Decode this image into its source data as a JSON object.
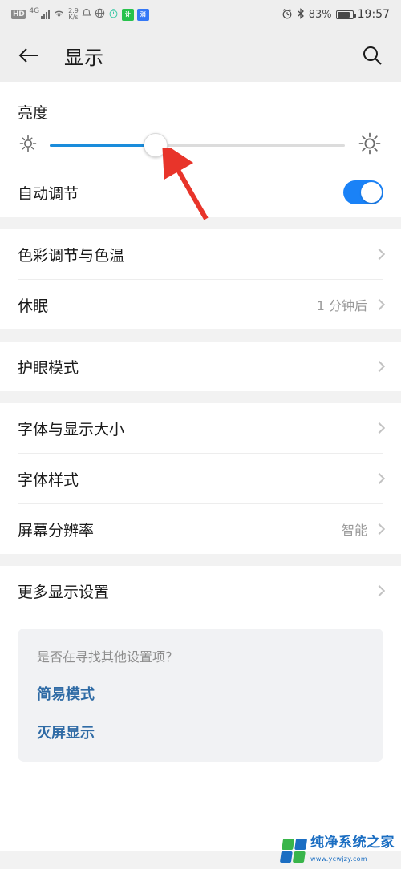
{
  "status_bar": {
    "hd_label": "HD",
    "network_type": "4G",
    "signal_icon": "signal-bars-icon",
    "wifi_icon": "wifi-icon",
    "data_rate_value": "2.9",
    "data_rate_unit": "K/s",
    "silent_icon": "bell-silent-icon",
    "globe_icon": "globe-icon",
    "timer_icon": "stopwatch-icon",
    "chip_green_label": "计",
    "chip_blue_label": "消",
    "alarm_icon": "alarm-clock-icon",
    "bluetooth_icon": "bluetooth-icon",
    "battery_percent": "83%",
    "battery_icon": "battery-icon",
    "time": "19:57"
  },
  "app_bar": {
    "back_icon": "back-arrow-icon",
    "title": "显示",
    "search_icon": "search-icon"
  },
  "brightness": {
    "label": "亮度",
    "low_icon": "sun-low-icon",
    "high_icon": "sun-high-icon",
    "value_percent": 36,
    "fill_color": "#1a8cdb",
    "track_color": "#dcdcdc"
  },
  "auto_brightness": {
    "label": "自动调节",
    "toggle_on": true,
    "toggle_color": "#1a82f7"
  },
  "sections": [
    {
      "rows": [
        {
          "label": "色彩调节与色温",
          "value": "",
          "chevron": true
        },
        {
          "label": "休眠",
          "value": "1 分钟后",
          "chevron": true
        }
      ]
    },
    {
      "rows": [
        {
          "label": "护眼模式",
          "value": "",
          "chevron": true
        }
      ]
    },
    {
      "rows": [
        {
          "label": "字体与显示大小",
          "value": "",
          "chevron": true
        },
        {
          "label": "字体样式",
          "value": "",
          "chevron": true
        },
        {
          "label": "屏幕分辨率",
          "value": "智能",
          "chevron": true
        }
      ]
    },
    {
      "rows": [
        {
          "label": "更多显示设置",
          "value": "",
          "chevron": true
        }
      ]
    }
  ],
  "suggestion": {
    "question": "是否在寻找其他设置项？",
    "links": [
      "简易模式",
      "灭屏显示"
    ]
  },
  "annotation": {
    "arrow_color": "#e8342a",
    "points_to": "brightness-slider-thumb"
  },
  "watermark": {
    "name": "纯净系统之家",
    "url": "www.ycwjzy.com"
  }
}
